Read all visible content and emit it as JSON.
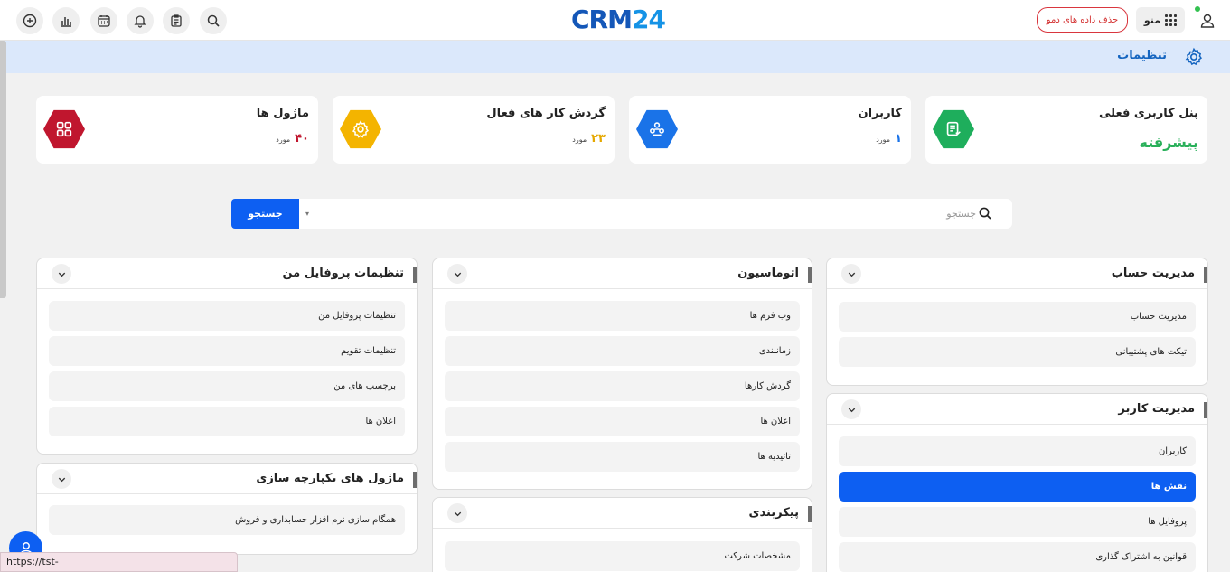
{
  "header": {
    "logo_main": "CRM",
    "logo_num": "24",
    "demo_button": "حذف داده های دمو",
    "menu_label": "منو",
    "icons": [
      "add-icon",
      "chart-icon",
      "calendar-icon",
      "bell-icon",
      "clipboard-icon",
      "search-icon",
      "grid-icon",
      "user-icon"
    ]
  },
  "breadcrumb": {
    "title": "تنظیمات",
    "icon": "gear-icon"
  },
  "stats": [
    {
      "title": "پنل کاربری فعلی",
      "value": "پیشرفته",
      "color": "#1eae5c",
      "icon": "document-icon"
    },
    {
      "title": "کاربران",
      "value": "۱",
      "unit": "مورد",
      "color": "#1a73e8",
      "icon": "users-icon"
    },
    {
      "title": "گردش کار های فعال",
      "value": "۲۳",
      "unit": "مورد",
      "color": "#f4b400",
      "icon": "gear-icon"
    },
    {
      "title": "ماژول ها",
      "value": "۴۰",
      "unit": "مورد",
      "color": "#c0162e",
      "icon": "modules-icon"
    }
  ],
  "search": {
    "placeholder": "جستجو",
    "button": "جستجو"
  },
  "panels": {
    "account": {
      "title": "مدیریت حساب",
      "items": [
        "مدیریت حساب",
        "تیکت های پشتیبانی"
      ]
    },
    "users": {
      "title": "مدیریت کاربر",
      "items": [
        "کاربران",
        "نقش ها",
        "پروفایل ها",
        "قوانین به اشتراک گذاری"
      ],
      "active_index": 1
    },
    "automation": {
      "title": "اتوماسیون",
      "items": [
        "وب فرم ها",
        "زمانبندی",
        "گردش کارها",
        "اعلان ها",
        "تائیدیه ها"
      ]
    },
    "config": {
      "title": "پیکربندی",
      "items": [
        "مشخصات شرکت"
      ]
    },
    "profile": {
      "title": "تنظیمات پروفایل من",
      "items": [
        "تنظیمات پروفایل من",
        "تنظیمات تقویم",
        "برچسب های من",
        "اعلان ها"
      ]
    },
    "integration": {
      "title": "ماژول های یکپارچه سازی",
      "items": [
        "همگام سازی نرم افزار حسابداری و فروش"
      ]
    }
  },
  "status_url": "https://tst-dmoo.crm24.io/settings/Roles/Index",
  "colors": {
    "primary": "#0d5ff2",
    "crumb_bg": "#dbe8fb",
    "demo_red": "#d32f2f"
  }
}
